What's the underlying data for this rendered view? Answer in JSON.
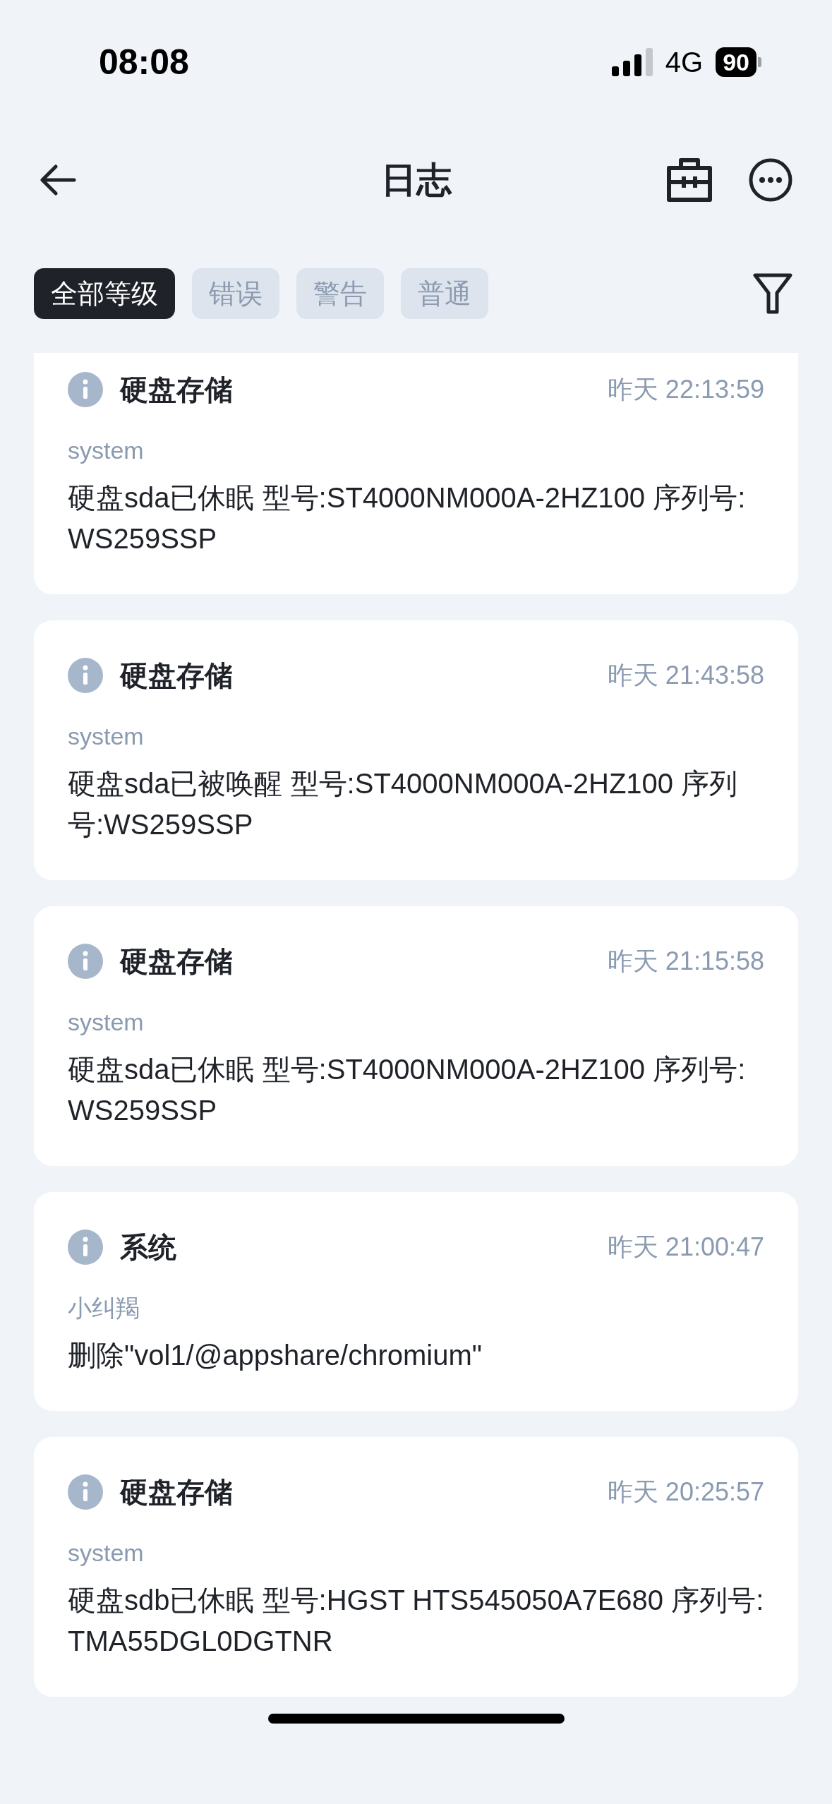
{
  "status_bar": {
    "time": "08:08",
    "network": "4G",
    "battery": "90"
  },
  "nav": {
    "title": "日志"
  },
  "tabs": [
    {
      "label": "全部等级",
      "selected": true
    },
    {
      "label": "错误",
      "selected": false
    },
    {
      "label": "警告",
      "selected": false
    },
    {
      "label": "普通",
      "selected": false
    }
  ],
  "logs": [
    {
      "category": "硬盘存储",
      "time": "昨天 22:13:59",
      "source": "system",
      "message": "硬盘sda已休眠 型号:ST4000NM000A-2HZ100 序列号:WS259SSP"
    },
    {
      "category": "硬盘存储",
      "time": "昨天 21:43:58",
      "source": "system",
      "message": "硬盘sda已被唤醒 型号:ST4000NM000A-2HZ100 序列号:WS259SSP"
    },
    {
      "category": "硬盘存储",
      "time": "昨天 21:15:58",
      "source": "system",
      "message": "硬盘sda已休眠 型号:ST4000NM000A-2HZ100 序列号:WS259SSP"
    },
    {
      "category": "系统",
      "time": "昨天 21:00:47",
      "source": "小纠羯",
      "message": "删除\"vol1/@appshare/chromium\""
    },
    {
      "category": "硬盘存储",
      "time": "昨天 20:25:57",
      "source": "system",
      "message": "硬盘sdb已休眠 型号:HGST HTS545050A7E680 序列号:TMA55DGL0DGTNR"
    }
  ]
}
